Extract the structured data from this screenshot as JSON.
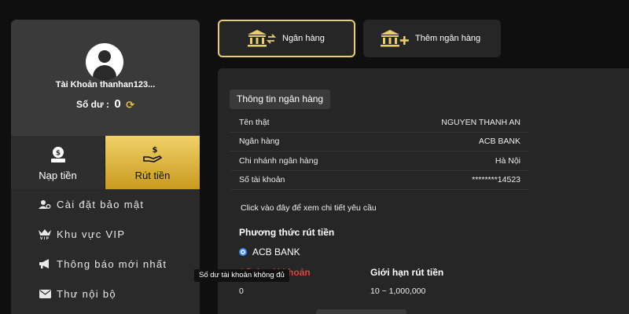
{
  "sidebar": {
    "account_label": "Tài Khoản thanhan123...",
    "balance_label": "Số dư :",
    "balance_value": "0",
    "actions": {
      "deposit": "Nạp tiền",
      "withdraw": "Rút tiền"
    },
    "menu": [
      {
        "label": "Cài đặt bảo mật",
        "icon": "user-gear-icon"
      },
      {
        "label": "Khu vực VIP",
        "icon": "vip-crown-icon"
      },
      {
        "label": "Thông báo mới nhất",
        "icon": "megaphone-icon"
      },
      {
        "label": "Thư nội bộ",
        "icon": "mail-icon"
      }
    ]
  },
  "tabs": [
    {
      "label": "Ngân hàng",
      "icon": "bank-transfer-icon",
      "active": true
    },
    {
      "label": "Thêm ngân hàng",
      "icon": "bank-add-icon",
      "active": false
    }
  ],
  "bank_info": {
    "section_title": "Thông tin ngân hàng",
    "rows": [
      {
        "key": "Tên thật",
        "value": "NGUYEN THANH AN"
      },
      {
        "key": "Ngân hàng",
        "value": "ACB BANK"
      },
      {
        "key": "Chi nhánh ngân hàng",
        "value": "Hà Nội"
      },
      {
        "key": "Số tài khoản",
        "value": "********14523"
      }
    ],
    "detail_link": "Click vào đây để xem chi tiết yêu cầu"
  },
  "withdraw": {
    "method_title": "Phương thức rút tiền",
    "selected_method": "ACB BANK",
    "col1_header": "Số dư tài khoản",
    "col2_header": "Giới hạn rút tiền",
    "col1_value": "0",
    "col2_value": "10 ~ 1,000,000"
  },
  "tooltip": "Số dư tài khoản không đủ",
  "colors": {
    "accent_gold": "#e7d06a",
    "button_gold": "#d9ad34",
    "radio_blue": "#3d8af7",
    "warning_red": "#d9443c",
    "panel_bg": "#262626"
  }
}
